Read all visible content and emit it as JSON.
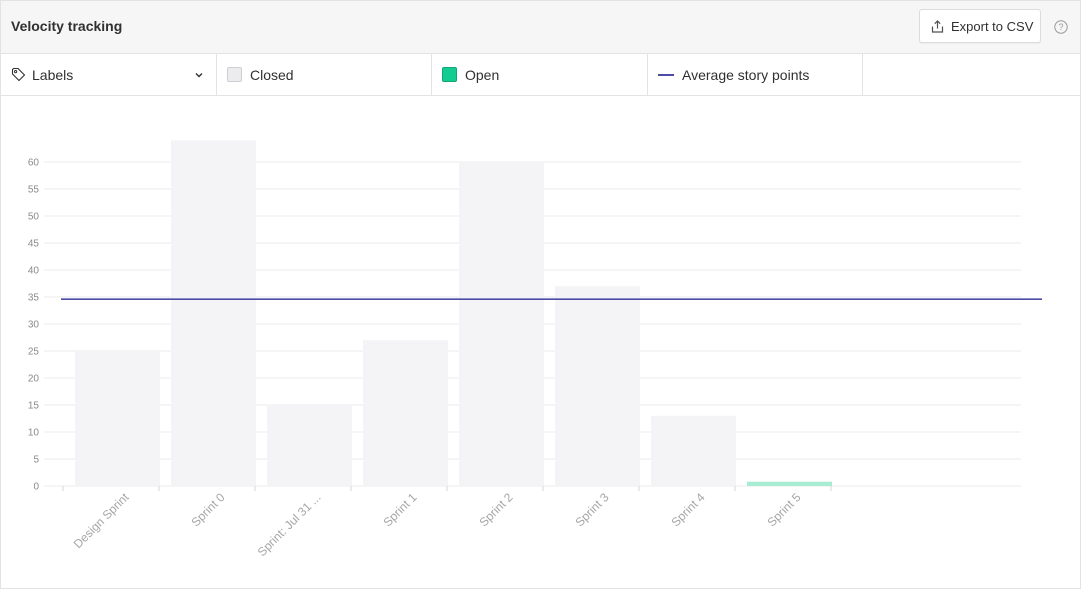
{
  "header": {
    "title": "Velocity tracking",
    "export_label": "Export to CSV"
  },
  "icons": {
    "export": "export-icon",
    "help": "help-icon",
    "tag": "tag-icon",
    "chevron": "chevron-down-icon"
  },
  "legend": {
    "labels_label": "Labels",
    "closed_label": "Closed",
    "open_label": "Open",
    "avg_label": "Average story points"
  },
  "colors": {
    "closed": "#f4f4f6",
    "open": "#a8ecd4",
    "open_swatch": "#12cc91",
    "average_line": "#4b4ba8",
    "grid": "#ebebeb",
    "tick_text": "#8a8a8a"
  },
  "chart_data": {
    "type": "bar",
    "categories": [
      "Design Sprint",
      "Sprint 0",
      "Sprint: Jul 31 ...",
      "Sprint 1",
      "Sprint 2",
      "Sprint 3",
      "Sprint 4",
      "Sprint 5"
    ],
    "series": [
      {
        "name": "Closed",
        "values": [
          25,
          64,
          15,
          27,
          60,
          37,
          13,
          0
        ]
      },
      {
        "name": "Open",
        "values": [
          0,
          0,
          0,
          0,
          0,
          0,
          0,
          0.8
        ]
      }
    ],
    "average": 34.6,
    "yticks": [
      0,
      5,
      10,
      15,
      20,
      25,
      30,
      35,
      40,
      45,
      50,
      55,
      60
    ],
    "ylim": [
      0,
      64
    ],
    "grid": true,
    "legend_position": "top"
  }
}
